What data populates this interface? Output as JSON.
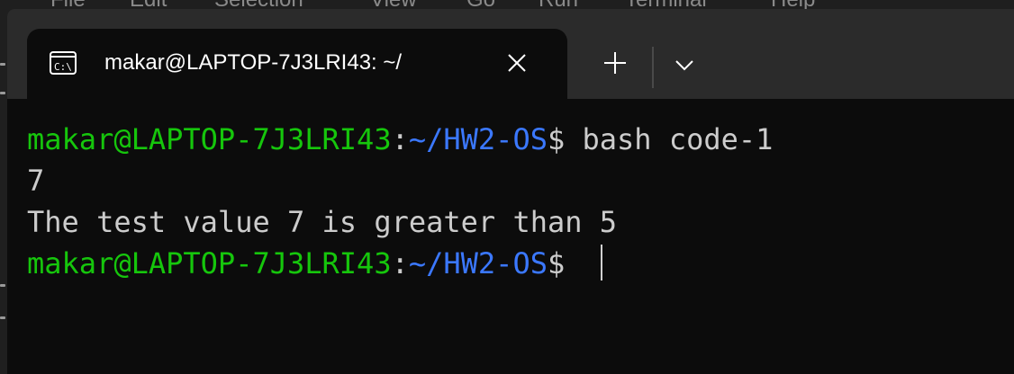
{
  "background_app": {
    "menu_items": [
      "File",
      "Edit",
      "Selection",
      "View",
      "Go",
      "Run",
      "Terminal",
      "Help"
    ]
  },
  "tab": {
    "title": "makar@LAPTOP-7J3LRI43: ~/",
    "icon": "cmd-icon"
  },
  "titlebar": {
    "new_tab_icon": "plus-icon",
    "dropdown_icon": "chevron-down-icon"
  },
  "terminal": {
    "lines": [
      {
        "user_host": "makar@LAPTOP-7J3LRI43",
        "sep": ":",
        "path": "~/HW2-OS",
        "prompt": "$ ",
        "command": "bash code-1"
      },
      {
        "output": "7"
      },
      {
        "output": "The test value 7 is greater than 5"
      },
      {
        "user_host": "makar@LAPTOP-7J3LRI43",
        "sep": ":",
        "path": "~/HW2-OS",
        "prompt": "$ ",
        "command": ""
      }
    ]
  },
  "colors": {
    "user_host": "#16c60c",
    "path": "#3b78ff",
    "text": "#cccccc",
    "background": "#0c0c0c",
    "titlebar": "#2b2b2b"
  }
}
